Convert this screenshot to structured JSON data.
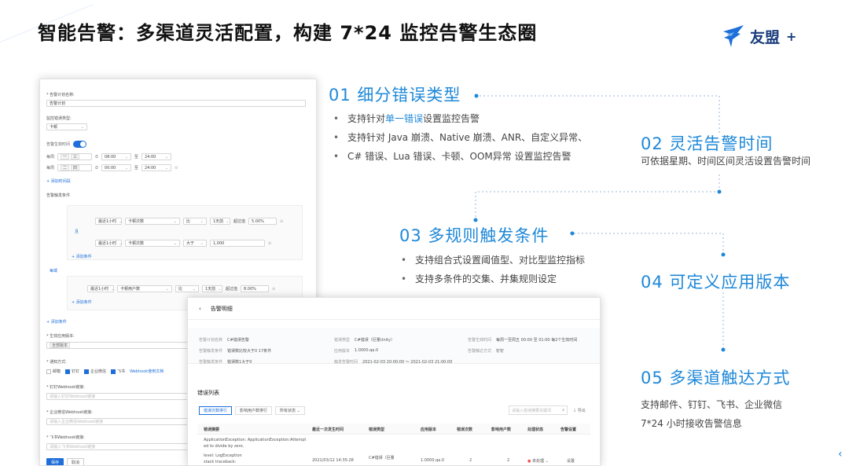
{
  "title": "智能告警：多渠道灵活配置，构建 7*24 监控告警生态圈",
  "logo": {
    "text": "友盟",
    "plus": "+"
  },
  "sections": {
    "s1": {
      "heading": "01 细分错误类型",
      "b1_pre": "支持针对",
      "b1_link": "单一错误",
      "b1_post": "设置监控告警",
      "b2_l1": "支持针对 Java 崩溃、Native 崩溃、ANR、自定义异常、",
      "b2_l2": "C# 错误、Lua 错误、卡顿、OOM异常 设置监控告警"
    },
    "s2": {
      "heading": "02 灵活告警时间",
      "desc": "可依据星期、时间区间灵活设置告警时间"
    },
    "s3": {
      "heading": "03  多规则触发条件",
      "b1": "支持组合式设置阈值型、对比型监控指标",
      "b2": "支持多条件的交集、并集规则设定"
    },
    "s4": {
      "heading": "04  可定义应用版本"
    },
    "s5": {
      "heading": "05  多渠道触达方式",
      "d1": "支持邮件、钉钉、飞书、企业微信",
      "d2": "7*24 小时接收告警信息"
    }
  },
  "card1": {
    "plan_name_label": "* 告警计划名称:",
    "plan_name_value": "告警计划",
    "type_label": "监控错误类型:",
    "type_value": "卡顿",
    "time_label": "告警生效时间",
    "week_label": "每周",
    "week_tag1": "一",
    "week_tag2": "三",
    "t1_start": "08:00",
    "t_to": "至",
    "t1_end": "24:00",
    "week_tag3": "二",
    "week_tag4": "四",
    "t2_start": "00:00",
    "t2_end": "24:00",
    "add_time": "+ 添加时间段",
    "cond_label": "告警触发条件",
    "and_label": "且",
    "or_label": "每或",
    "r1_a": "最近1小时",
    "r1_b": "卡顿次数",
    "r1_c": "比",
    "r1_d": "1天前",
    "r1_e": "超过值",
    "r1_f": "5.00%",
    "r2_a": "最近1小时",
    "r2_b": "卡顿次数",
    "r2_c": "大于",
    "r2_d": "1,000",
    "add_cond": "+ 添加条件",
    "r3_a": "最近1小时",
    "r3_b": "卡顿用户数",
    "r3_c": "比",
    "r3_d": "1天前",
    "r3_e": "超过值",
    "r3_f": "8.00%",
    "add_cond2": "+ 添加条件",
    "add_cond3": "+ 添加条件",
    "ver_label": "* 生效应用版本:",
    "ver_value": "全部版本",
    "notify_label": "* 通知方式:",
    "n_mail": "邮箱",
    "n_ding": "钉钉",
    "n_wx": "企业微信",
    "n_fs": "飞书",
    "n_hook": "Webhook使用文档",
    "ding_label": "* 钉钉Webhook链接:",
    "ding_ph": "请输入钉钉Webhook链接",
    "wx_label": "* 企业微信Webhook链接:",
    "wx_ph": "请输入企业微信Webhook链接",
    "fs_label": "* 飞书Webhook链接:",
    "fs_ph": "请输入飞书Webhook链接",
    "save": "保存",
    "cancel": "取消"
  },
  "card2": {
    "back": "‹",
    "header": "告警明细",
    "k1": "告警计划名称",
    "v1": "C#错误告警",
    "k2": "告警触发条件",
    "v2": "错误数比较大于0  17条件",
    "k3": "告警触发条件",
    "v3": "错误数1大于0",
    "k4": "错误类型",
    "v4": "C#错误（巨量Unity）",
    "k5": "应用版本",
    "v5": "1.0000.qa.0",
    "k6": "触发告警时间",
    "v6": "2021-02-03 20:00:00 ～ 2021-02-03 21:00:00",
    "k7": "告警生效时间",
    "v7": "每周一至周五 00:00 至 01:00 每2个生效时间",
    "k8": "告警触达方式",
    "v8": "钉钉",
    "section": "错误列表",
    "tab1": "错误次数排行",
    "tab2": "影响用户数排行",
    "tab3": "所有状态",
    "search_ph": "请输入错误摘要关键词",
    "export": "导出",
    "cols": [
      "错误摘要",
      "最近一次发生时间",
      "错误类型",
      "应用版本",
      "错误次数",
      "影响用户数",
      "处理状态",
      "告警设置"
    ],
    "row": {
      "summary1": "ApplicationException: ApplicationException:Attempt",
      "summary2": "ed to divide by zero.",
      "summary3": "level: LogException",
      "summary4": "stack traceback:",
      "time": "2021/03/12 14:35:28",
      "type": "C#错误（巨量",
      "ver": "1.0000.qa.0",
      "count": "2",
      "users": "2",
      "status": "未处理",
      "action": "设置"
    }
  }
}
